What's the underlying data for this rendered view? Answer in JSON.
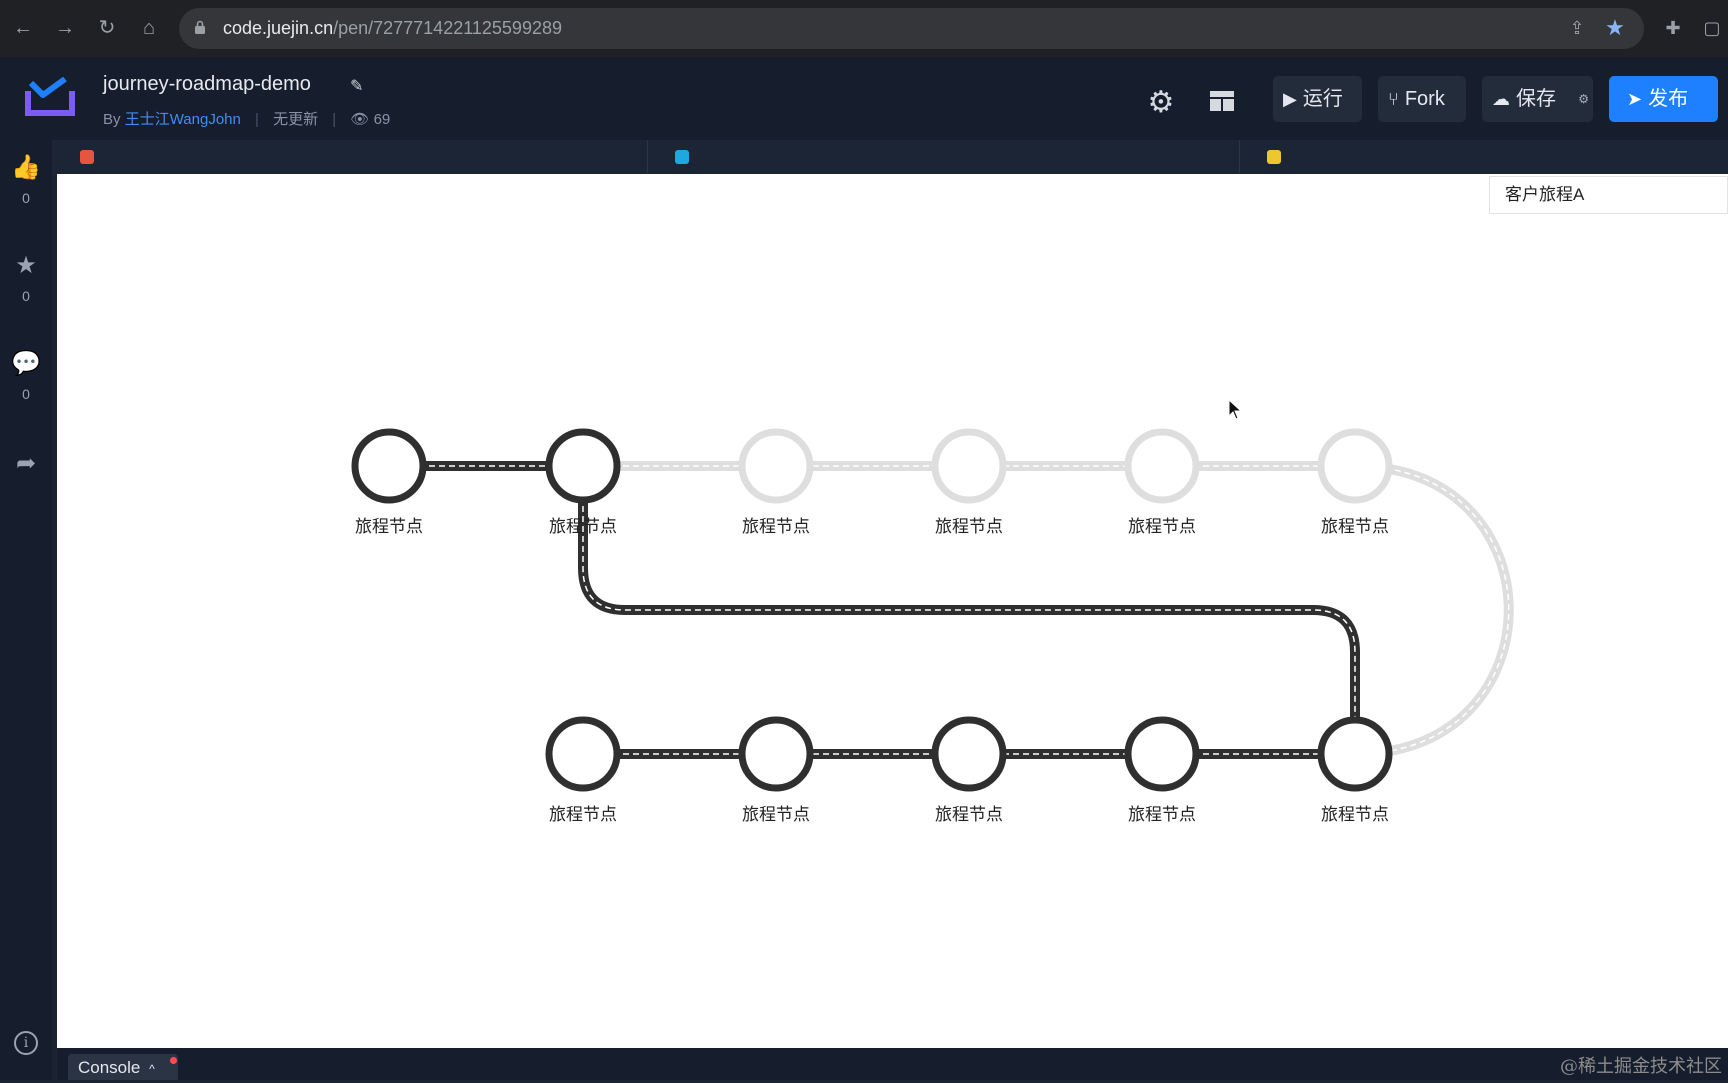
{
  "browser": {
    "url_host": "code.juejin.cn",
    "url_path": "/pen/7277714221125599289"
  },
  "header": {
    "title": "journey-roadmap-demo",
    "by_prefix": "By",
    "author": "王士江WangJohn",
    "update_status": "无更新",
    "view_count": "69",
    "run_label": "运行",
    "fork_label": "Fork",
    "save_label": "保存",
    "publish_label": "发布"
  },
  "sidebar": {
    "like_count": "0",
    "star_count": "0",
    "comment_count": "0"
  },
  "editor_tabs": [
    {
      "kind": "html",
      "color": "#e8553f",
      "glyph": "</>"
    },
    {
      "kind": "css",
      "color": "#1ea7e1",
      "glyph": "*"
    },
    {
      "kind": "js",
      "color": "#f0c630",
      "glyph": "{}"
    }
  ],
  "preview": {
    "journey_select_value": "客户旅程A",
    "completed_color": "#2f2f2f",
    "pending_color": "#dedede",
    "nodes": [
      {
        "label": "旅程节点",
        "status": "completed"
      },
      {
        "label": "旅程节点",
        "status": "completed"
      },
      {
        "label": "旅程节点",
        "status": "pending"
      },
      {
        "label": "旅程节点",
        "status": "pending"
      },
      {
        "label": "旅程节点",
        "status": "pending"
      },
      {
        "label": "旅程节点",
        "status": "pending"
      },
      {
        "label": "旅程节点",
        "status": "completed"
      },
      {
        "label": "旅程节点",
        "status": "completed"
      },
      {
        "label": "旅程节点",
        "status": "completed"
      },
      {
        "label": "旅程节点",
        "status": "completed"
      },
      {
        "label": "旅程节点",
        "status": "completed"
      }
    ]
  },
  "footer": {
    "console_label": "Console",
    "watermark": "@稀土掘金技术社区"
  }
}
